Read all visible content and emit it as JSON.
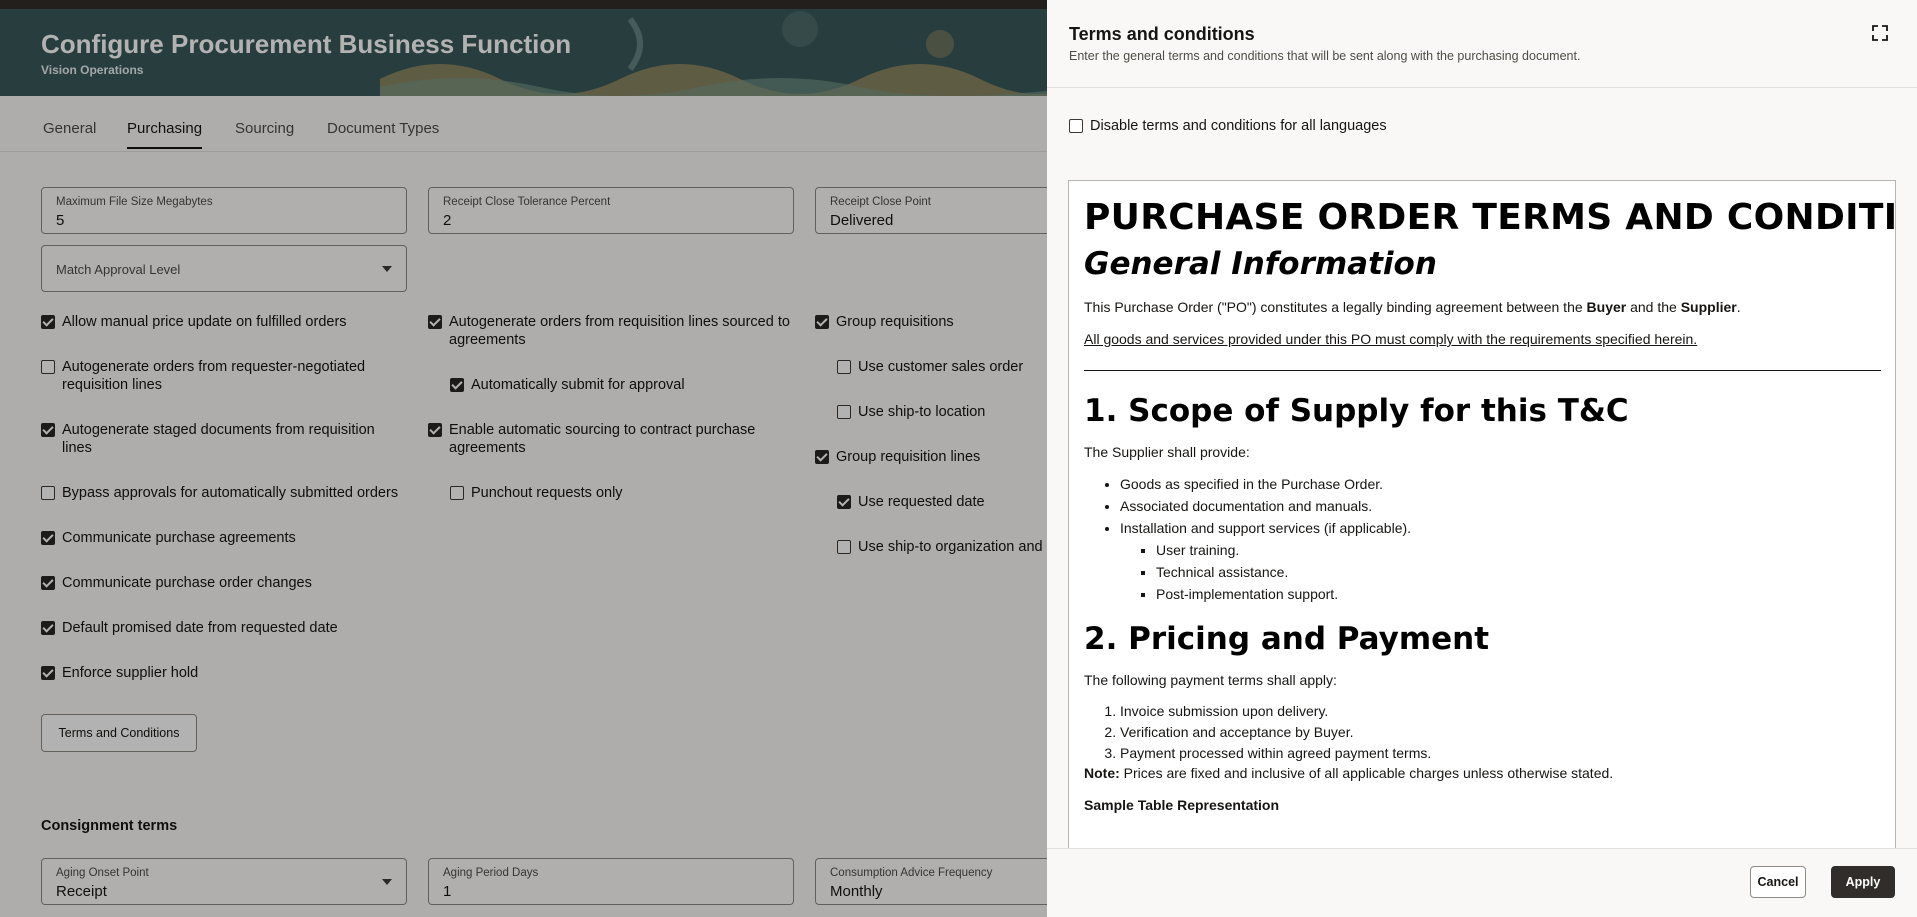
{
  "page": {
    "title": "Configure Procurement Business Function",
    "subtitle": "Vision Operations",
    "tabs": [
      "General",
      "Purchasing",
      "Sourcing",
      "Document Types"
    ],
    "active_tab": "Purchasing",
    "fields": {
      "max_file_size": {
        "label": "Maximum File Size Megabytes",
        "value": "5"
      },
      "receipt_close_tolerance": {
        "label": "Receipt Close Tolerance Percent",
        "value": "2"
      },
      "receipt_close_point": {
        "label": "Receipt Close Point",
        "value": "Delivered"
      },
      "match_approval_level": {
        "placeholder": "Match Approval Level"
      }
    },
    "checkboxes_col1": [
      {
        "label": "Allow manual price update on fulfilled orders",
        "checked": true
      },
      {
        "label": "Autogenerate orders from requester-negotiated requisition lines",
        "checked": false
      },
      {
        "label": "Autogenerate staged documents from requisition lines",
        "checked": true
      },
      {
        "label": "Bypass approvals for automatically submitted orders",
        "checked": false
      },
      {
        "label": "Communicate purchase agreements",
        "checked": true
      },
      {
        "label": "Communicate purchase order changes",
        "checked": true
      },
      {
        "label": "Default promised date from requested date",
        "checked": true
      },
      {
        "label": "Enforce supplier hold",
        "checked": true
      }
    ],
    "checkboxes_col2": [
      {
        "label": "Autogenerate orders from requisition lines sourced to agreements",
        "checked": true
      },
      {
        "label": "Automatically submit for approval",
        "checked": true
      },
      {
        "label": "Enable automatic sourcing to contract purchase agreements",
        "checked": true
      },
      {
        "label": "Punchout requests only",
        "checked": false
      }
    ],
    "checkboxes_col3": [
      {
        "label": "Group requisitions",
        "checked": true
      },
      {
        "label": "Use customer sales order",
        "checked": false
      },
      {
        "label": "Use ship-to location",
        "checked": false
      },
      {
        "label": "Group requisition lines",
        "checked": true
      },
      {
        "label": "Use requested date",
        "checked": true
      },
      {
        "label": "Use ship-to organization and",
        "checked": false
      }
    ],
    "terms_button": "Terms and Conditions",
    "consignment": {
      "title": "Consignment terms",
      "aging_onset_point": {
        "label": "Aging Onset Point",
        "value": "Receipt"
      },
      "aging_period_days": {
        "label": "Aging Period Days",
        "value": "1"
      },
      "consumption_advice_frequency": {
        "label": "Consumption Advice Frequency",
        "value": "Monthly"
      }
    }
  },
  "drawer": {
    "title": "Terms and conditions",
    "subtitle": "Enter the general terms and conditions that will be sent along with the purchasing document.",
    "disable_checkbox": {
      "label": "Disable terms and conditions for all languages",
      "checked": false
    },
    "content": {
      "heading": "PURCHASE ORDER TERMS AND CONDITIONS",
      "general_heading": "General Information",
      "intro_a": "This Purchase Order (\"PO\") constitutes a legally binding agreement between the ",
      "intro_buyer": "Buyer",
      "intro_b": " and the ",
      "intro_supplier": "Supplier",
      "intro_c": ".",
      "compliance": "All goods and services provided under this PO must comply with the requirements specified herein.",
      "section1": "1. Scope of Supply for this T&C",
      "section1_intro": "The Supplier shall provide:",
      "supply_items": [
        "Goods as specified in the Purchase Order.",
        "Associated documentation and manuals.",
        "Installation and support services (if applicable)."
      ],
      "support_items": [
        "User training.",
        "Technical assistance.",
        "Post-implementation support."
      ],
      "section2": "2. Pricing and Payment",
      "section2_intro": "The following payment terms shall apply:",
      "payment_steps": [
        "Invoice submission upon delivery.",
        "Verification and acceptance by Buyer.",
        "Payment processed within agreed payment terms."
      ],
      "note_label": "Note:",
      "note_text": " Prices are fixed and inclusive of all applicable charges unless otherwise stated.",
      "table_heading": "Sample Table Representation"
    },
    "cancel": "Cancel",
    "apply": "Apply"
  }
}
